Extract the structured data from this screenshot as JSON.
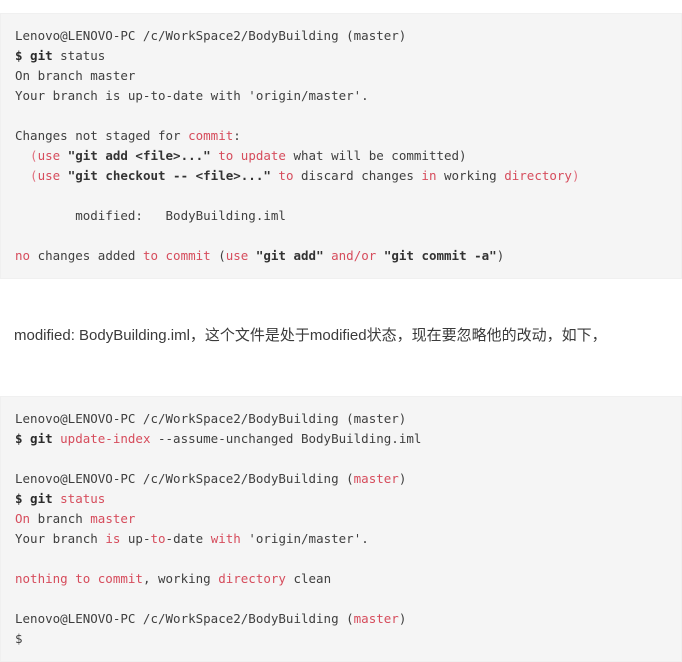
{
  "theme": {
    "page_background": "#ffffff",
    "code_background": "#f5f5f5",
    "code_border": "#f0f0f0",
    "keyword_color": "#d64c5c",
    "keyword_alt_color": "#e0707f",
    "string_color": "#333333",
    "text_color": "#3f3f3f",
    "prose_color": "#3a3a3a"
  },
  "block1": {
    "lines": [
      {
        "id": "prompt-1",
        "tokens": [
          {
            "t": "Lenovo@LENOVO-PC /c/WorkSpace2/BodyBuilding (master)",
            "c": "plain"
          }
        ]
      },
      {
        "id": "command-git-status",
        "tokens": [
          {
            "t": "$ git ",
            "c": "bold"
          },
          {
            "t": "status",
            "c": "plain"
          }
        ]
      },
      {
        "id": "on-branch-master",
        "tokens": [
          {
            "t": "On branch master",
            "c": "plain"
          }
        ]
      },
      {
        "id": "branch-uptodate",
        "tokens": [
          {
            "t": "Your branch is up-to-date with 'origin/master'.",
            "c": "plain"
          }
        ]
      },
      {
        "id": "blank-1",
        "tokens": []
      },
      {
        "id": "changes-not-staged",
        "tokens": [
          {
            "t": "Changes not staged for ",
            "c": "plain"
          },
          {
            "t": "commit",
            "c": "kw"
          },
          {
            "t": ":",
            "c": "plain"
          }
        ]
      },
      {
        "id": "hint-git-add",
        "tokens": [
          {
            "t": "  (",
            "c": "kw2"
          },
          {
            "t": "use",
            "c": "kw"
          },
          {
            "t": " ",
            "c": "plain"
          },
          {
            "t": "\"git add <file>...\"",
            "c": "str"
          },
          {
            "t": " ",
            "c": "plain"
          },
          {
            "t": "to update",
            "c": "kw"
          },
          {
            "t": " what will be committed)",
            "c": "plain"
          }
        ]
      },
      {
        "id": "hint-git-checkout",
        "tokens": [
          {
            "t": "  (",
            "c": "kw2"
          },
          {
            "t": "use",
            "c": "kw"
          },
          {
            "t": " ",
            "c": "plain"
          },
          {
            "t": "\"git checkout -- <file>...\"",
            "c": "str"
          },
          {
            "t": " ",
            "c": "plain"
          },
          {
            "t": "to",
            "c": "kw"
          },
          {
            "t": " discard changes ",
            "c": "plain"
          },
          {
            "t": "in",
            "c": "kw"
          },
          {
            "t": " working ",
            "c": "plain"
          },
          {
            "t": "directory",
            "c": "kw"
          },
          {
            "t": ")",
            "c": "kw2"
          }
        ]
      },
      {
        "id": "blank-2",
        "tokens": []
      },
      {
        "id": "modified-file",
        "tokens": [
          {
            "t": "        modified:   BodyBuilding.iml",
            "c": "plain"
          }
        ]
      },
      {
        "id": "blank-3",
        "tokens": []
      },
      {
        "id": "no-changes-added",
        "tokens": [
          {
            "t": "no",
            "c": "kw"
          },
          {
            "t": " changes added ",
            "c": "plain"
          },
          {
            "t": "to commit",
            "c": "kw"
          },
          {
            "t": " (",
            "c": "plain"
          },
          {
            "t": "use",
            "c": "kw"
          },
          {
            "t": " ",
            "c": "plain"
          },
          {
            "t": "\"git add\"",
            "c": "str"
          },
          {
            "t": " ",
            "c": "plain"
          },
          {
            "t": "and/or",
            "c": "kw"
          },
          {
            "t": " ",
            "c": "plain"
          },
          {
            "t": "\"git commit -a\"",
            "c": "str"
          },
          {
            "t": ")",
            "c": "plain"
          }
        ]
      }
    ]
  },
  "prose": {
    "paragraph": "modified:  BodyBuilding.iml，这个文件是处于modified状态，现在要忽略他的改动，如下，"
  },
  "block2": {
    "lines": [
      {
        "id": "prompt-2",
        "tokens": [
          {
            "t": "Lenovo@LENOVO-PC /c/WorkSpace2/BodyBuilding (master)",
            "c": "plain"
          }
        ]
      },
      {
        "id": "command-update-index",
        "tokens": [
          {
            "t": "$ git ",
            "c": "bold"
          },
          {
            "t": "update-index",
            "c": "kw"
          },
          {
            "t": " --assume-unchanged BodyBuilding.iml",
            "c": "plain"
          }
        ]
      },
      {
        "id": "blank-4",
        "tokens": []
      },
      {
        "id": "prompt-3",
        "tokens": [
          {
            "t": "Lenovo@LENOVO-PC /c/WorkSpace2/BodyBuilding (",
            "c": "plain"
          },
          {
            "t": "master",
            "c": "kw"
          },
          {
            "t": ")",
            "c": "plain"
          }
        ]
      },
      {
        "id": "command-git-status-2",
        "tokens": [
          {
            "t": "$ git ",
            "c": "bold"
          },
          {
            "t": "status",
            "c": "kw"
          }
        ]
      },
      {
        "id": "on-branch-master-2",
        "tokens": [
          {
            "t": "On",
            "c": "kw"
          },
          {
            "t": " branch ",
            "c": "plain"
          },
          {
            "t": "master",
            "c": "kw"
          }
        ]
      },
      {
        "id": "branch-uptodate-2",
        "tokens": [
          {
            "t": "Your branch ",
            "c": "plain"
          },
          {
            "t": "is",
            "c": "kw"
          },
          {
            "t": " up-",
            "c": "plain"
          },
          {
            "t": "to",
            "c": "kw"
          },
          {
            "t": "-date ",
            "c": "plain"
          },
          {
            "t": "with",
            "c": "kw"
          },
          {
            "t": " 'origin/master'.",
            "c": "plain"
          }
        ]
      },
      {
        "id": "blank-5",
        "tokens": []
      },
      {
        "id": "nothing-to-commit",
        "tokens": [
          {
            "t": "nothing to commit",
            "c": "kw"
          },
          {
            "t": ", working ",
            "c": "plain"
          },
          {
            "t": "directory",
            "c": "kw"
          },
          {
            "t": " clean",
            "c": "plain"
          }
        ]
      },
      {
        "id": "blank-6",
        "tokens": []
      },
      {
        "id": "prompt-4",
        "tokens": [
          {
            "t": "Lenovo@LENOVO-PC /c/WorkSpace2/BodyBuilding (",
            "c": "plain"
          },
          {
            "t": "master",
            "c": "kw"
          },
          {
            "t": ")",
            "c": "plain"
          }
        ]
      },
      {
        "id": "prompt-final",
        "tokens": [
          {
            "t": "$",
            "c": "plain"
          }
        ]
      }
    ]
  }
}
